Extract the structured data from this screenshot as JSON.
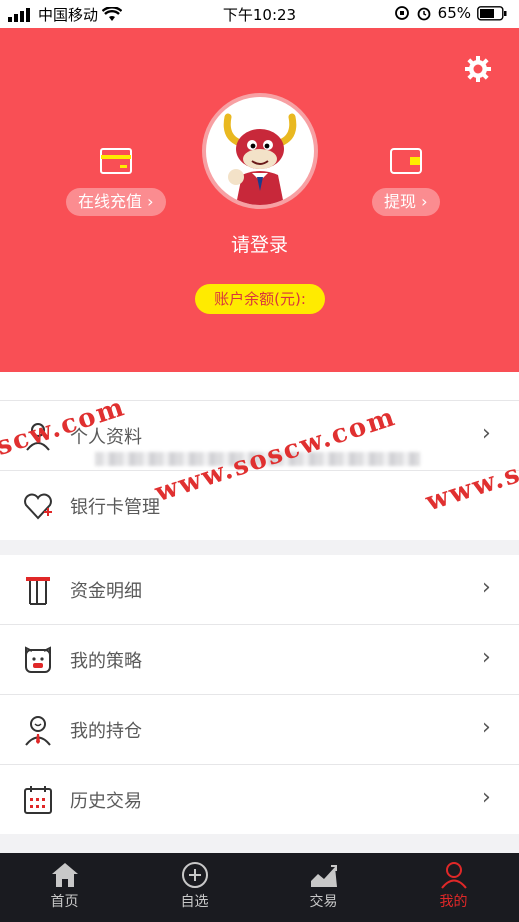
{
  "status_bar": {
    "carrier": "中国移动",
    "time": "下午10:23",
    "battery": "65%"
  },
  "header": {
    "recharge_label": "在线充值",
    "withdraw_label": "提现",
    "login_text": "请登录",
    "balance_label": "账户余额(元):"
  },
  "menu_group1": [
    {
      "label": "个人资料"
    },
    {
      "label": "银行卡管理"
    }
  ],
  "menu_group2": [
    {
      "label": "资金明细"
    },
    {
      "label": "我的策略"
    },
    {
      "label": "我的持仓"
    },
    {
      "label": "历史交易"
    }
  ],
  "tabs": [
    {
      "label": "首页"
    },
    {
      "label": "自选"
    },
    {
      "label": "交易"
    },
    {
      "label": "我的"
    }
  ],
  "watermark": {
    "text1": "scw.com",
    "text2": "www.soscw.com",
    "text3": "www.so"
  },
  "colors": {
    "header_bg": "#f94f55",
    "balance_bg": "#ffeb00",
    "active_tab": "#e02828"
  }
}
